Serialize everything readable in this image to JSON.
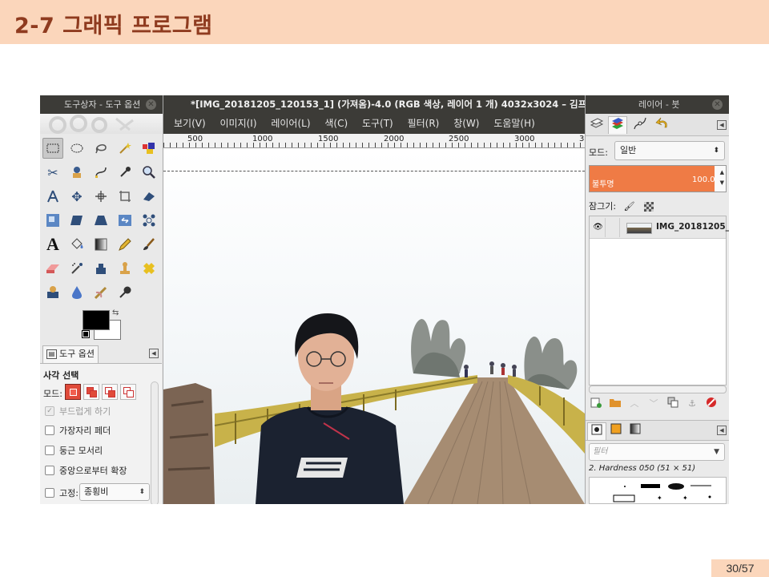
{
  "slide": {
    "title": "2-7 그래픽 프로그램",
    "page": "30/57"
  },
  "toolbox": {
    "title": "도구상자 - 도구 옵션",
    "tool_options_tab": "도구 옵션",
    "heading": "사각 선택",
    "mode_label": "모드:",
    "options": [
      {
        "label": "부드럽게 하기",
        "checked": true,
        "enabled": false
      },
      {
        "label": "가장자리 페더",
        "checked": false,
        "enabled": true
      },
      {
        "label": "둥근 모서리",
        "checked": false,
        "enabled": true
      },
      {
        "label": "중앙으로부터 확장",
        "checked": false,
        "enabled": true
      }
    ],
    "fixed_label": "고정:",
    "fixed_value": "종횡비",
    "foreground_color": "#000000",
    "background_color": "#ffffff"
  },
  "image_window": {
    "title": "*[IMG_20181205_120153_1] (가져옴)-4.0 (RGB 색상, 레이어 1 개) 4032x3024 – 김프",
    "menu": [
      "보기(V)",
      "이미지(I)",
      "레이어(L)",
      "색(C)",
      "도구(T)",
      "필터(R)",
      "창(W)",
      "도움말(H)"
    ],
    "ruler_labels": [
      "500",
      "1000",
      "1500",
      "2000",
      "2500",
      "3000",
      "3"
    ]
  },
  "layers_dock": {
    "title": "레이어 - 붓",
    "mode_label": "모드:",
    "mode_value": "일반",
    "opacity_label": "불투명",
    "opacity_value": "100.0",
    "lock_label": "잠그기:",
    "layer_name": "IMG_20181205_1",
    "filter_placeholder": "필터",
    "brush_name": "2. Hardness 050 (51 × 51)"
  },
  "colors": {
    "title_bar": "#fbd6bb",
    "title_text": "#8f3b1f",
    "gimp_titlebar": "#3c3b37",
    "opacity_fill": "#ef7b45"
  }
}
